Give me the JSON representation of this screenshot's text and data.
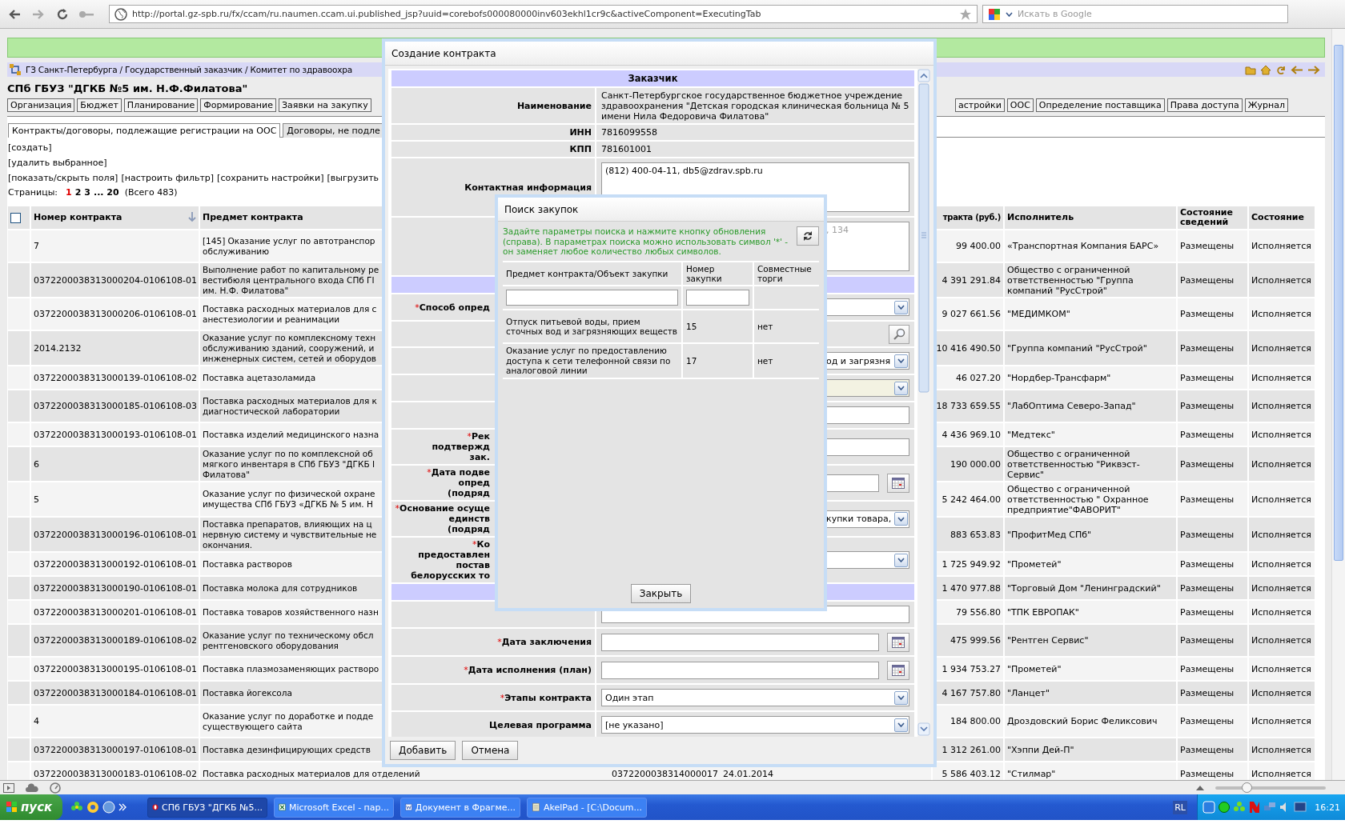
{
  "browser": {
    "url": "http://portal.gz-spb.ru/fx/ccam/ru.naumen.ccam.ui.published_jsp?uuid=corebofs000080000inv603ekhl1cr9c&activeComponent=ExecutingTab",
    "search_placeholder": "Искать в Google"
  },
  "breadcrumb": "ГЗ Санкт-Петербурга / Государственный заказчик / Комитет по здравоохра",
  "org_title": "СПб ГБУЗ \"ДГКБ №5 им. Н.Ф.Филатова\"",
  "nav_left": [
    "Организация",
    "Бюджет",
    "Планирование",
    "Формирование",
    "Заявки на закупку"
  ],
  "nav_right": [
    "астройки",
    "ООС",
    "Определение поставщика",
    "Права доступа",
    "Журнал"
  ],
  "tabs": [
    {
      "label": "Контракты/договоры, подлежащие регистрации на ООС",
      "selected": true
    },
    {
      "label": "Договоры, не подле",
      "selected": false
    }
  ],
  "actions": [
    [
      "[создать]"
    ],
    [
      "[удалить выбранное]"
    ],
    [
      "[показать/скрыть поля]",
      "[настроить фильтр]",
      "[сохранить настройки]",
      "[выгрузить"
    ]
  ],
  "pagination": {
    "label": "Страницы:",
    "pages": [
      {
        "label": "1",
        "selected": true
      },
      {
        "label": "2",
        "selected": false
      },
      {
        "label": "3",
        "selected": false
      },
      {
        "label": "... 20",
        "selected": false
      }
    ],
    "total": "(Всего 483)"
  },
  "table": {
    "select_all": {
      "checked": false
    },
    "columns_left": [
      "Номер контракта",
      "Предмет контракта"
    ],
    "columns_right": [
      "тракта (руб.)",
      "Исполнитель",
      "Состояние сведений",
      "Состояние"
    ],
    "rows": [
      {
        "number": "7",
        "subject": "[145] Оказание услуг по автотранспор\nобслуживанию",
        "price": "99 400.00",
        "executor": "«Транспортная Компания БАРС»",
        "info": "Размещены",
        "state": "Исполняется"
      },
      {
        "number": "0372200038313000204-0106108-01",
        "subject": "Выполнение работ по капитальному ре\nвестибюля центрального входа СПб ГІ\nим. Н.Ф. Филатова\"",
        "price": "4 391 291.84",
        "executor": "Общество с ограниченной ответственностью \"Группа компаний \"РусСтрой\"",
        "info": "Размещены",
        "state": "Исполняется"
      },
      {
        "number": "0372200038313000206-0106108-01",
        "subject": "Поставка расходных материалов для с\nанестезиологии и реанимации",
        "price": "9 027 661.56",
        "executor": "\"МЕДИМКОМ\"",
        "info": "Размещены",
        "state": "Исполняется"
      },
      {
        "number": "2014.2132",
        "subject": "Оказание услуг по комплексному техн\nобслуживанию зданий, сооружений, и\nинженерных систем, сетей и оборудов",
        "price": "10 416 490.50",
        "executor": "\"Группа компаний \"РусСтрой\"",
        "info": "Размещены",
        "state": "Исполняется"
      },
      {
        "number": "0372200038313000139-0106108-02",
        "subject": "Поставка ацетазоламида",
        "price": "46 027.20",
        "executor": "\"Нордбер-Трансфарм\"",
        "info": "Размещены",
        "state": "Исполняется"
      },
      {
        "number": "0372200038313000185-0106108-03",
        "subject": "Поставка расходных материалов для к\nдиагностической лаборатории",
        "price": "18 733 659.55",
        "executor": "\"ЛабОптима Северо-Запад\"",
        "info": "Размещены",
        "state": "Исполняется"
      },
      {
        "number": "0372200038313000193-0106108-01",
        "subject": "Поставка изделий медицинского назна",
        "price": "4 436 969.10",
        "executor": "\"Медтекс\"",
        "info": "Размещены",
        "state": "Исполняется"
      },
      {
        "number": "6",
        "subject": "Оказание услуг по по комплексной об\nмягкого инвентаря в СПб ГБУЗ \"ДГКБ І\nФилатова\"",
        "price": "190 000.00",
        "executor": "Общество с ограниченной ответственностью \"Риквэст-Сервис\"",
        "info": "Размещены",
        "state": "Исполняется"
      },
      {
        "number": "5",
        "subject": "Оказание услуг по физической охране\nимущества СПб ГБУЗ «ДГКБ № 5 им. Н",
        "price": "5 242 464.00",
        "executor": "Общество с ограниченной ответственностью \" Охранное предприятие\"ФАВОРИТ\"",
        "info": "Размещены",
        "state": "Исполняется"
      },
      {
        "number": "0372200038313000196-0106108-01",
        "subject": "Поставка препаратов, влияющих на ц\nнервную систему и чувствительные не\nокончания.",
        "price": "883 653.83",
        "executor": "\"ПрофитМед СПб\"",
        "info": "Размещены",
        "state": "Исполняется"
      },
      {
        "number": "0372200038313000192-0106108-01",
        "subject": "Поставка растворов",
        "price": "1 725 949.92",
        "executor": "\"Прометей\"",
        "info": "Размещены",
        "state": "Исполняется"
      },
      {
        "number": "0372200038313000190-0106108-01",
        "subject": "Поставка молока для сотрудников",
        "price": "1 470 977.88",
        "executor": "\"Торговый Дом \"Ленинградский\"",
        "info": "Размещены",
        "state": "Исполняется"
      },
      {
        "number": "0372200038313000201-0106108-01",
        "subject": "Поставка товаров хозяйственного назн",
        "price": "79 556.80",
        "executor": "\"ТПК ЕВРОПАК\"",
        "info": "Размещены",
        "state": "Исполняется"
      },
      {
        "number": "0372200038313000189-0106108-02",
        "subject": "Оказание услуг по техническому обсл\nрентгеновского оборудования",
        "price": "475 999.56",
        "executor": "\"Рентген Сервис\"",
        "info": "Размещены",
        "state": "Исполняется"
      },
      {
        "number": "0372200038313000195-0106108-01",
        "subject": "Поставка плазмозаменяющих растворо",
        "price": "1 934 753.27",
        "executor": "\"Прометей\"",
        "info": "Размещены",
        "state": "Исполняется"
      },
      {
        "number": "0372200038313000184-0106108-01",
        "subject": "Поставка йогексола",
        "price": "4 167 757.80",
        "executor": "\"Ланцет\"",
        "info": "Размещены",
        "state": "Исполняется"
      },
      {
        "number": "4",
        "subject": "Оказание услуг по доработке и подде\nсуществующего сайта",
        "price": "184 800.00",
        "executor": "Дроздовский Борис Феликсович",
        "info": "Размещены",
        "state": "Исполняется"
      },
      {
        "number": "0372200038313000197-0106108-01",
        "subject": "Поставка дезинфицирующих средств",
        "price": "1 312 261.00",
        "executor": "\"Хэппи Дей-П\"",
        "info": "Размещены",
        "state": "Исполняется"
      },
      {
        "number": "0372200038313000183-0106108-02",
        "subject": "Поставка расходных материалов для отделений",
        "middle": [
          "0372200038314000017",
          "24.01.2014"
        ],
        "price": "5 586 403.12",
        "executor": "\"Стилмар\"",
        "info": "Размещены",
        "state": "Исполняется"
      }
    ]
  },
  "contract_dialog": {
    "title": "Создание контракта",
    "rows": [
      {
        "kind": "section",
        "label": "Заказчик"
      },
      {
        "kind": "text",
        "label": "Наименование",
        "value": "Санкт-Петербургское государственное бюджетное учреждение здравоохранения \"Детская городская клиническая больница № 5 имени Нила Федоровича Филатова\""
      },
      {
        "kind": "text",
        "label": "ИНН",
        "value": "7816099558"
      },
      {
        "kind": "text",
        "label": "КПП",
        "value": "781601001"
      },
      {
        "kind": "textarea",
        "label": "Контактная информация",
        "value": "(812) 400-04-11, db5@zdrav.spb.ru"
      }
    ],
    "rows_behind_search": [
      {
        "kind": "textarea",
        "placeholder": ", 134"
      },
      {
        "kind": "section"
      },
      {
        "kind": "select",
        "mark": "*",
        "label": "Способ опред"
      },
      {
        "kind": "search"
      },
      {
        "kind": "select",
        "value": "од и загрязня"
      },
      {
        "kind": "select",
        "disabled": true
      },
      {
        "kind": "input"
      },
      {
        "kind": "input",
        "mark": "*",
        "label": "Рек\nподтвержд\nзак."
      },
      {
        "kind": "date",
        "mark": "*",
        "label": "Дата подве\nопред\n(подряд"
      },
      {
        "kind": "select",
        "mark": "*",
        "label": "Основание осуще\nединств\n(подряд",
        "value": "купки товара,"
      },
      {
        "kind": "select",
        "mark": "*",
        "label": "Ко\nпредоставлен\nпостав\nбелорусских то"
      },
      {
        "kind": "section"
      }
    ],
    "rows_after": [
      {
        "kind": "input"
      },
      {
        "kind": "date",
        "mark": "*",
        "label": "Дата заключения"
      },
      {
        "kind": "date",
        "mark": "*",
        "label": "Дата исполнения (план)"
      },
      {
        "kind": "select",
        "mark": "*",
        "label": "Этапы контракта",
        "value": "Один этап"
      },
      {
        "kind": "select",
        "label": "Целевая программа",
        "value": "[не указано]"
      }
    ],
    "buttons": [
      "Добавить",
      "Отмена"
    ]
  },
  "search_dialog": {
    "title": "Поиск закупок",
    "hint": "Задайте параметры поиска и нажмите кнопку обновления (справа). В параметрах поиска можно использовать символ '*' - он заменяет любое количество любых символов.",
    "columns": [
      "Предмет контракта/Объект закупки",
      "Номер закупки",
      "Совместные торги"
    ],
    "rows": [
      [
        "Отпуск питьевой воды, прием сточных вод и загрязняющих веществ",
        "15",
        "нет"
      ],
      [
        "Оказание услуг по предоставлению доступа к сети телефонной связи по аналоговой линии",
        "17",
        "нет"
      ]
    ],
    "close": "Закрыть"
  },
  "status_bar": {
    "zoom": {
      "level": 0.28
    }
  },
  "taskbar": {
    "start": "пуск",
    "tasks": [
      {
        "kind": "browser",
        "label": "СПб ГБУЗ \"ДГКБ №5...",
        "selected": true
      },
      {
        "kind": "excel",
        "label": "Microsoft Excel - пар...",
        "selected": false
      },
      {
        "kind": "word",
        "label": "Документ в Фрагме...",
        "selected": false
      },
      {
        "kind": "notepad",
        "label": "AkelPad - [C:\\Docum...",
        "selected": false
      }
    ],
    "language": "RL",
    "clock": "16:21"
  }
}
